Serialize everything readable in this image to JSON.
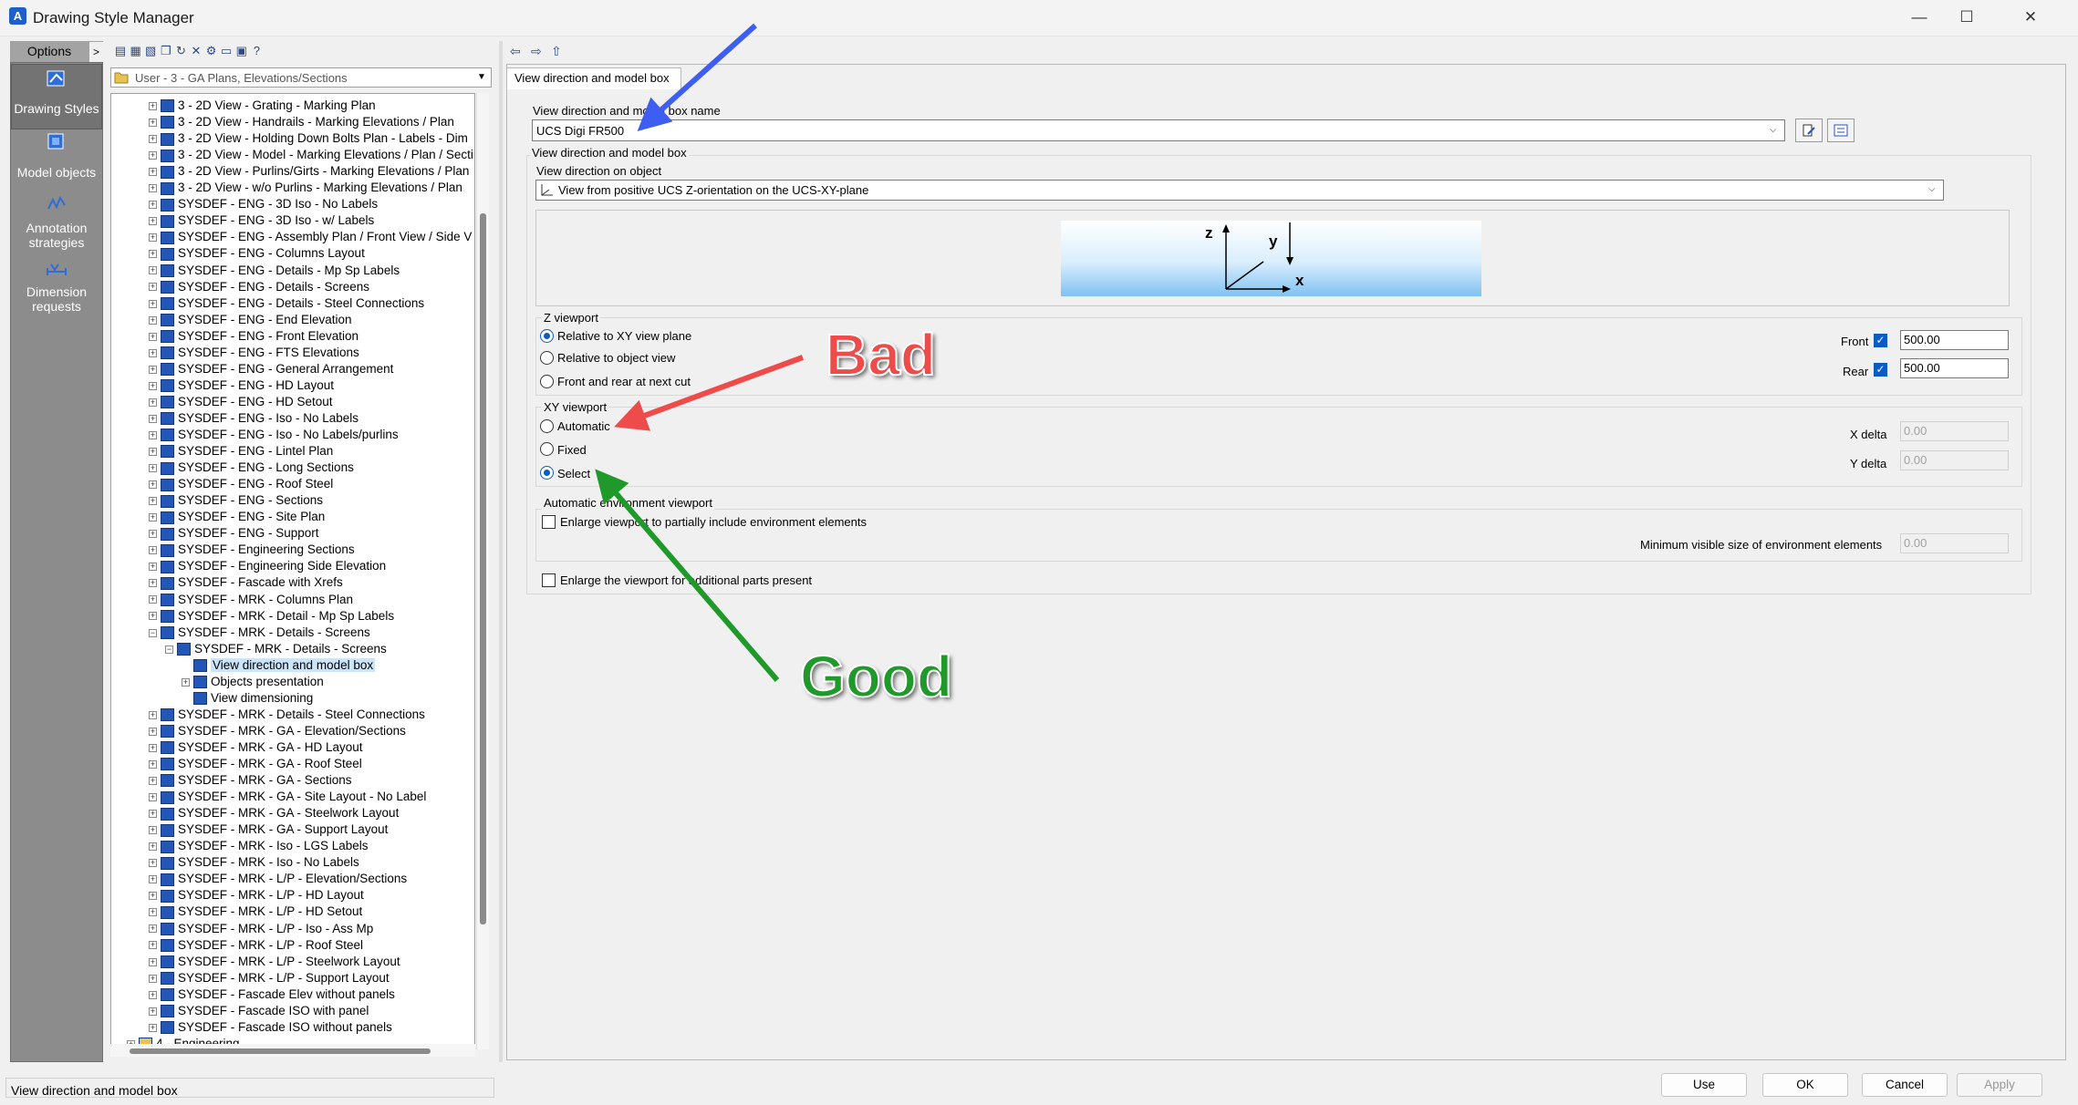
{
  "window": {
    "title": "Drawing Style Manager",
    "app_icon": "A",
    "minimize_glyph": "—",
    "maximize_glyph": "☐",
    "close_glyph": "✕"
  },
  "leftbar": {
    "options_label": "Options",
    "options_arrow": ">",
    "items": [
      {
        "label": "Drawing Styles",
        "icon": "drawing-styles-icon"
      },
      {
        "label": "Model objects",
        "icon": "model-objects-icon"
      },
      {
        "label": "Annotation strategies",
        "icon": "annotation-strategies-icon"
      },
      {
        "label": "Dimension requests",
        "icon": "dimension-requests-icon"
      }
    ]
  },
  "toolbar_icons": [
    "new-icon",
    "new-copy-icon",
    "import-icon",
    "copy-icon",
    "refresh-icon",
    "delete-icon",
    "settings-icon",
    "folder-icon",
    "export-icon",
    "help-icon"
  ],
  "category_select": {
    "value": "User - 3 - GA Plans, Elevations/Sections",
    "icon": "folder-icon"
  },
  "tree": {
    "items": [
      {
        "text": "3 - 2D View - Grating - Marking Plan",
        "level": 1,
        "exp": "+"
      },
      {
        "text": "3 - 2D View - Handrails - Marking Elevations / Plan",
        "level": 1,
        "exp": "+"
      },
      {
        "text": "3 - 2D View - Holding Down Bolts Plan - Labels - Dim",
        "level": 1,
        "exp": "+"
      },
      {
        "text": "3 - 2D View - Model - Marking Elevations / Plan / Secti",
        "level": 1,
        "exp": "+"
      },
      {
        "text": "3 - 2D View - Purlins/Girts - Marking Elevations / Plan",
        "level": 1,
        "exp": "+"
      },
      {
        "text": "3 - 2D View - w/o Purlins - Marking Elevations / Plan",
        "level": 1,
        "exp": "+"
      },
      {
        "text": "SYSDEF - ENG - 3D Iso - No Labels",
        "level": 1,
        "exp": "+"
      },
      {
        "text": "SYSDEF - ENG - 3D Iso - w/ Labels",
        "level": 1,
        "exp": "+"
      },
      {
        "text": "SYSDEF - ENG - Assembly Plan / Front View / Side V",
        "level": 1,
        "exp": "+"
      },
      {
        "text": "SYSDEF - ENG - Columns Layout",
        "level": 1,
        "exp": "+"
      },
      {
        "text": "SYSDEF - ENG - Details - Mp Sp Labels",
        "level": 1,
        "exp": "+"
      },
      {
        "text": "SYSDEF - ENG - Details - Screens",
        "level": 1,
        "exp": "+"
      },
      {
        "text": "SYSDEF - ENG - Details - Steel Connections",
        "level": 1,
        "exp": "+"
      },
      {
        "text": "SYSDEF - ENG - End Elevation",
        "level": 1,
        "exp": "+"
      },
      {
        "text": "SYSDEF - ENG - Front Elevation",
        "level": 1,
        "exp": "+"
      },
      {
        "text": "SYSDEF - ENG - FTS Elevations",
        "level": 1,
        "exp": "+"
      },
      {
        "text": "SYSDEF - ENG - General Arrangement",
        "level": 1,
        "exp": "+"
      },
      {
        "text": "SYSDEF - ENG - HD Layout",
        "level": 1,
        "exp": "+"
      },
      {
        "text": "SYSDEF - ENG - HD Setout",
        "level": 1,
        "exp": "+"
      },
      {
        "text": "SYSDEF - ENG - Iso - No Labels",
        "level": 1,
        "exp": "+"
      },
      {
        "text": "SYSDEF - ENG - Iso - No Labels/purlins",
        "level": 1,
        "exp": "+"
      },
      {
        "text": "SYSDEF - ENG - Lintel Plan",
        "level": 1,
        "exp": "+"
      },
      {
        "text": "SYSDEF - ENG - Long Sections",
        "level": 1,
        "exp": "+"
      },
      {
        "text": "SYSDEF - ENG - Roof Steel",
        "level": 1,
        "exp": "+"
      },
      {
        "text": "SYSDEF - ENG - Sections",
        "level": 1,
        "exp": "+"
      },
      {
        "text": "SYSDEF - ENG - Site Plan",
        "level": 1,
        "exp": "+"
      },
      {
        "text": "SYSDEF - ENG - Support",
        "level": 1,
        "exp": "+"
      },
      {
        "text": "SYSDEF - Engineering Sections",
        "level": 1,
        "exp": "+"
      },
      {
        "text": "SYSDEF - Engineering Side Elevation",
        "level": 1,
        "exp": "+"
      },
      {
        "text": "SYSDEF - Fascade with Xrefs",
        "level": 1,
        "exp": "+"
      },
      {
        "text": "SYSDEF - MRK - Columns Plan",
        "level": 1,
        "exp": "+"
      },
      {
        "text": "SYSDEF - MRK - Detail - Mp Sp Labels",
        "level": 1,
        "exp": "+"
      },
      {
        "text": "SYSDEF - MRK - Details - Screens",
        "level": 1,
        "exp": "−"
      },
      {
        "text": "SYSDEF - MRK - Details - Screens",
        "level": 2,
        "exp": "−"
      },
      {
        "text": "View direction and model box",
        "level": 3,
        "exp": "",
        "selected": true
      },
      {
        "text": "Objects presentation",
        "level": 3,
        "exp": "+"
      },
      {
        "text": "View dimensioning",
        "level": 3,
        "exp": ""
      },
      {
        "text": "SYSDEF - MRK - Details - Steel Connections",
        "level": 1,
        "exp": "+"
      },
      {
        "text": "SYSDEF - MRK - GA - Elevation/Sections",
        "level": 1,
        "exp": "+"
      },
      {
        "text": "SYSDEF - MRK - GA - HD Layout",
        "level": 1,
        "exp": "+"
      },
      {
        "text": "SYSDEF - MRK - GA - Roof Steel",
        "level": 1,
        "exp": "+"
      },
      {
        "text": "SYSDEF - MRK - GA - Sections",
        "level": 1,
        "exp": "+"
      },
      {
        "text": "SYSDEF - MRK - GA - Site Layout - No Label",
        "level": 1,
        "exp": "+"
      },
      {
        "text": "SYSDEF - MRK - GA - Steelwork Layout",
        "level": 1,
        "exp": "+"
      },
      {
        "text": "SYSDEF - MRK - GA - Support Layout",
        "level": 1,
        "exp": "+"
      },
      {
        "text": "SYSDEF - MRK - Iso - LGS Labels",
        "level": 1,
        "exp": "+"
      },
      {
        "text": "SYSDEF - MRK - Iso - No Labels",
        "level": 1,
        "exp": "+"
      },
      {
        "text": "SYSDEF - MRK - L/P - Elevation/Sections",
        "level": 1,
        "exp": "+"
      },
      {
        "text": "SYSDEF - MRK - L/P - HD Layout",
        "level": 1,
        "exp": "+"
      },
      {
        "text": "SYSDEF - MRK - L/P - HD Setout",
        "level": 1,
        "exp": "+"
      },
      {
        "text": "SYSDEF - MRK - L/P - Iso - Ass Mp",
        "level": 1,
        "exp": "+"
      },
      {
        "text": "SYSDEF - MRK - L/P - Roof Steel",
        "level": 1,
        "exp": "+"
      },
      {
        "text": "SYSDEF - MRK - L/P - Steelwork Layout",
        "level": 1,
        "exp": "+"
      },
      {
        "text": "SYSDEF - MRK - L/P - Support Layout",
        "level": 1,
        "exp": "+"
      },
      {
        "text": "SYSDEF - Fascade Elev without panels",
        "level": 1,
        "exp": "+"
      },
      {
        "text": "SYSDEF - Fascade ISO with panel",
        "level": 1,
        "exp": "+"
      },
      {
        "text": "SYSDEF - Fascade ISO without panels",
        "level": 1,
        "exp": "+"
      },
      {
        "text": "4 - Engineering",
        "level": 0,
        "exp": "+"
      }
    ]
  },
  "nav": {
    "back": "⇦",
    "forward": "⇨",
    "up": "⇧"
  },
  "panel": {
    "tab_label": "View direction and model box",
    "name_label": "View direction and model box name",
    "name_value": "UCS Digi FR500",
    "group_label": "View direction and model box",
    "view_dir_label": "View direction on object",
    "view_dir_value": "View from positive UCS Z-orientation on the UCS-XY-plane",
    "axis_z": "z",
    "axis_y": "y",
    "axis_x": "x",
    "z_viewport": {
      "label": "Z viewport",
      "options": [
        "Relative to XY view plane",
        "Relative to object view",
        "Front and rear at next cut"
      ],
      "selected": 0,
      "front_label": "Front",
      "front_checked": true,
      "front_value": "500.00",
      "rear_label": "Rear",
      "rear_checked": true,
      "rear_value": "500.00"
    },
    "xy_viewport": {
      "label": "XY viewport",
      "options": [
        "Automatic",
        "Fixed",
        "Select"
      ],
      "selected": 2,
      "xdelta_label": "X delta",
      "xdelta_value": "0.00",
      "ydelta_label": "Y delta",
      "ydelta_value": "0.00"
    },
    "env_viewport": {
      "label": "Automatic environment viewport",
      "enlarge_label": "Enlarge viewport to partially include environment elements",
      "enlarge_checked": false,
      "minsize_label": "Minimum visible size of environment elements",
      "minsize_value": "0.00"
    },
    "enlarge_parts_label": "Enlarge the viewport for additional parts present",
    "enlarge_parts_checked": false
  },
  "annotations": {
    "bad": "Bad",
    "good": "Good",
    "colors": {
      "blue": "#3d5ef0",
      "red": "#ee4b4b",
      "green": "#1f9a2a"
    }
  },
  "status_text": "View direction and model box",
  "buttons": {
    "use": "Use",
    "ok": "OK",
    "cancel": "Cancel",
    "apply": "Apply"
  }
}
